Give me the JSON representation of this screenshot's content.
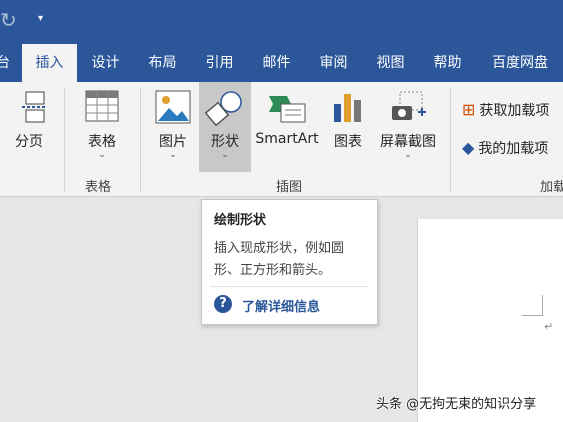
{
  "qat": {
    "redo_icon": "redo-icon",
    "customize_icon": "customize-qat-icon"
  },
  "tabs": [
    {
      "label": "台"
    },
    {
      "label": "插入"
    },
    {
      "label": "设计"
    },
    {
      "label": "布局"
    },
    {
      "label": "引用"
    },
    {
      "label": "邮件"
    },
    {
      "label": "审阅"
    },
    {
      "label": "视图"
    },
    {
      "label": "帮助"
    },
    {
      "label": "百度网盘"
    }
  ],
  "ribbon": {
    "page_break": "分页",
    "table": "表格",
    "picture": "图片",
    "shapes": "形状",
    "smartart": "SmartArt",
    "chart": "图表",
    "screenshot": "屏幕截图",
    "get_addins": "获取加载项",
    "my_addins": "我的加载项",
    "group_table": "表格",
    "group_illustrations": "插图",
    "group_addins": "加载"
  },
  "tooltip": {
    "title": "绘制形状",
    "description": "插入现成形状，例如圆形、正方形和箭头。",
    "help_glyph": "?",
    "link": "了解详细信息"
  },
  "document": {
    "return_mark": "↵"
  },
  "watermark": "头条 @无拘无束的知识分享"
}
